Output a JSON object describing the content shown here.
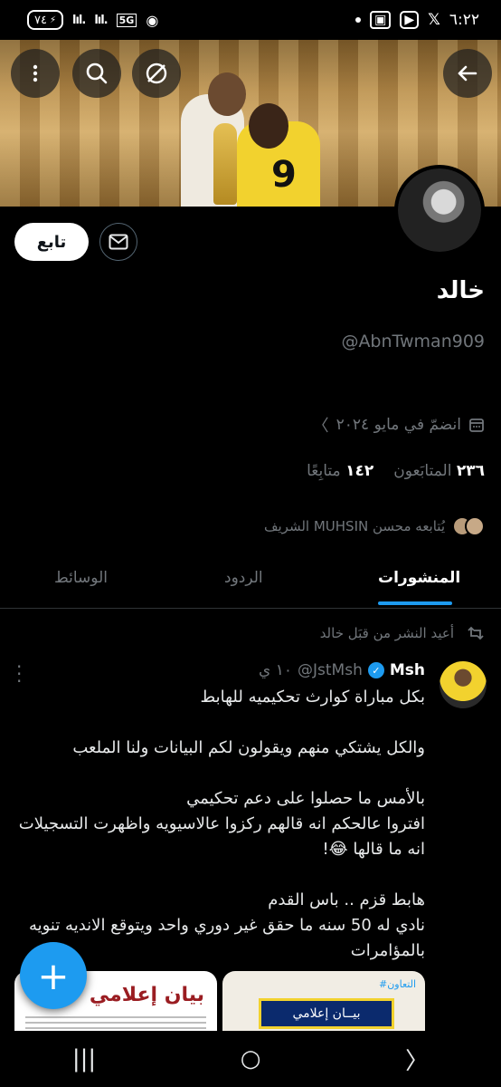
{
  "status_bar": {
    "time": "٦:٢٢",
    "battery": "٧٤",
    "signal1": "lıl.",
    "signal2": "lıl.",
    "network": "5G",
    "icons": [
      "x-icon",
      "youtube-icon",
      "message-icon",
      "dot"
    ]
  },
  "header": {
    "back_icon": "arrow-back-icon",
    "mute_icon": "no-notifications-icon",
    "search_icon": "search-icon",
    "more_icon": "more-vertical-icon"
  },
  "banner": {
    "jersey_number": "9"
  },
  "profile": {
    "follow_label": "تابع",
    "name": "خالد",
    "handle": "@AbnTwman909",
    "joined": "انضمّ في مايو ٢٠٢٤",
    "following_count": "١٤٢",
    "following_label": "متابِعًا",
    "followers_count": "٢٣٦",
    "followers_label": "المتابَعون",
    "followed_by": "يُتابعه محسن MUHSIN الشريف"
  },
  "tabs": [
    {
      "label": "المنشورات",
      "active": true
    },
    {
      "label": "الردود",
      "active": false
    },
    {
      "label": "الوسائط",
      "active": false
    }
  ],
  "post": {
    "repost_label": "أعيد النشر من قبَل خالد",
    "author_name": "Msh",
    "author_handle": "@JstMsh",
    "time": "١٠ ي",
    "body": "بكل مباراة كوارث تحكيميه للهابط\n\nوالكل يشتكي منهم ويقولون لكم البيانات ولنا الملعب\n\nبالأمس ما حصلوا على دعم تحكيمي\nافتروا عالحكم انه قالهم ركزوا عالاسيويه واظهرت التسجيلات انه ما قالها 😂!\n\nهابط قزم .. باس القدم\nنادي له 50 سنه ما حقق غير دوري واحد ويتوقع الانديه تنويه بالمؤامرات",
    "media": [
      {
        "title": "بيان إعلامي"
      },
      {
        "tag": "#التعاون",
        "badge": "بيــان إعلامي"
      }
    ]
  },
  "fab_label": "+",
  "nav": {
    "recents": "|||",
    "home": "○",
    "back": "〉"
  }
}
